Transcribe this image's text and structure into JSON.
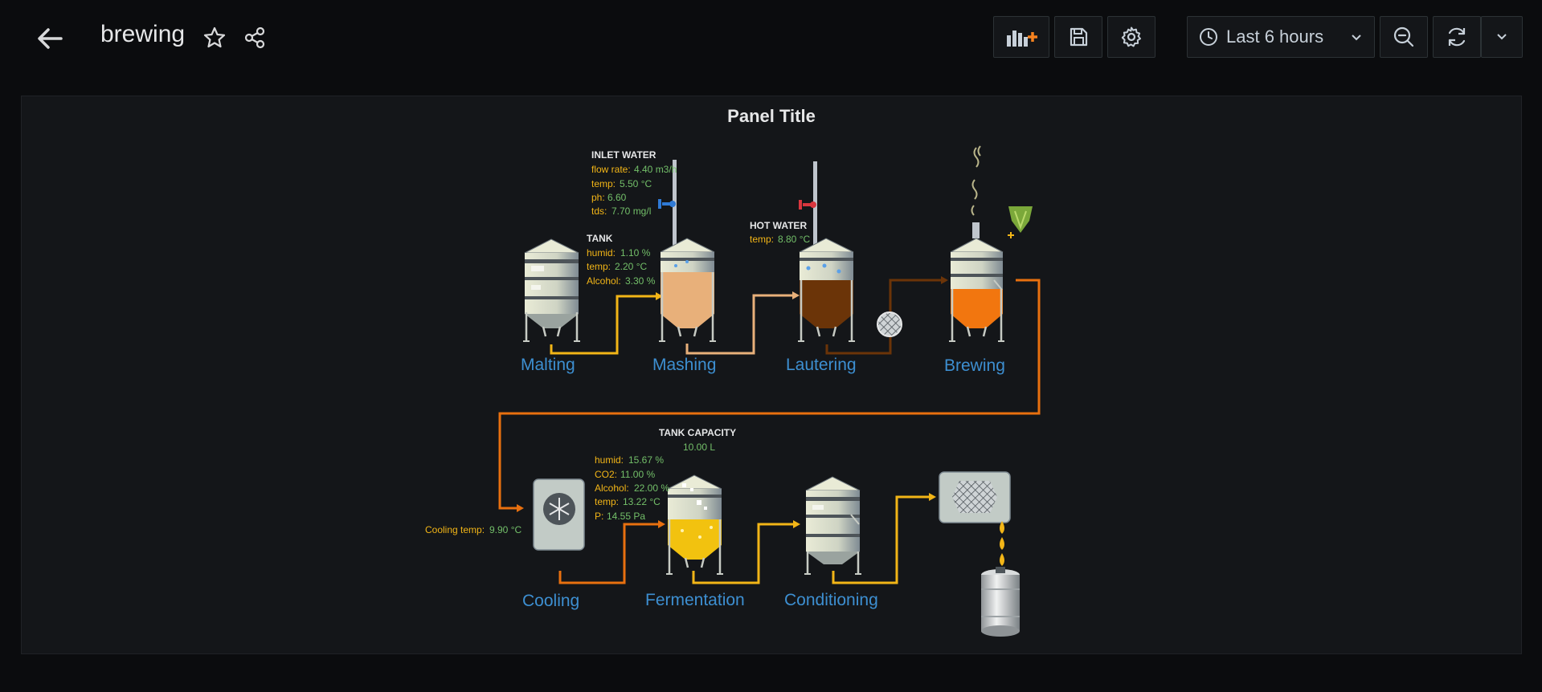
{
  "header": {
    "title": "brewing",
    "time_range": "Last 6 hours"
  },
  "panel": {
    "title": "Panel Title"
  },
  "stages": {
    "malting": "Malting",
    "mashing": "Mashing",
    "lautering": "Lautering",
    "brewing": "Brewing",
    "cooling": "Cooling",
    "fermentation": "Fermentation",
    "conditioning": "Conditioning"
  },
  "inlet_water": {
    "title": "INLET WATER",
    "flow_key": "flow rate:",
    "flow_val": "4.40 m3/h",
    "temp_key": "temp:",
    "temp_val": "5.50 °C",
    "ph_key": "ph:",
    "ph_val": "6.60",
    "tds_key": "tds:",
    "tds_val": "7.70 mg/l"
  },
  "tank": {
    "title": "TANK",
    "humid_key": "humid:",
    "humid_val": "1.10 %",
    "temp_key": "temp:",
    "temp_val": "2.20 °C",
    "alcohol_key": "Alcohol:",
    "alcohol_val": "3.30 %"
  },
  "hot_water": {
    "title": "HOT WATER",
    "temp_key": "temp:",
    "temp_val": "8.80 °C"
  },
  "tank_capacity": {
    "title": "TANK CAPACITY",
    "value": "10.00 L"
  },
  "fermentation_stats": {
    "humid_key": "humid:",
    "humid_val": "15.67 %",
    "co2_key": "CO2:",
    "co2_val": "11.00 %",
    "alcohol_key": "Alcohol:",
    "alcohol_val": "22.00 %",
    "temp_key": "temp:",
    "temp_val": "13.22 °C",
    "p_key": "P:",
    "p_val": "14.55 Pa"
  },
  "cooling_stats": {
    "temp_key": "Cooling temp:",
    "temp_val": "9.90 °C"
  },
  "colors": {
    "label_blue": "#3d8fd1",
    "key_yellow": "#f2b517",
    "value_green": "#73bf69",
    "pipe_yellow": "#f2b517",
    "pipe_orange": "#e8700f",
    "mash": "#e8b07a",
    "wort": "#6b3408",
    "brew": "#f2760f",
    "beer": "#f2c20f"
  },
  "icons": {
    "back": "arrow-left-icon",
    "star": "star-icon",
    "share": "share-icon",
    "add_panel": "add-panel-icon",
    "save": "save-icon",
    "settings": "gear-icon",
    "clock": "clock-icon",
    "zoom_out": "zoom-out-icon",
    "refresh": "refresh-icon"
  }
}
